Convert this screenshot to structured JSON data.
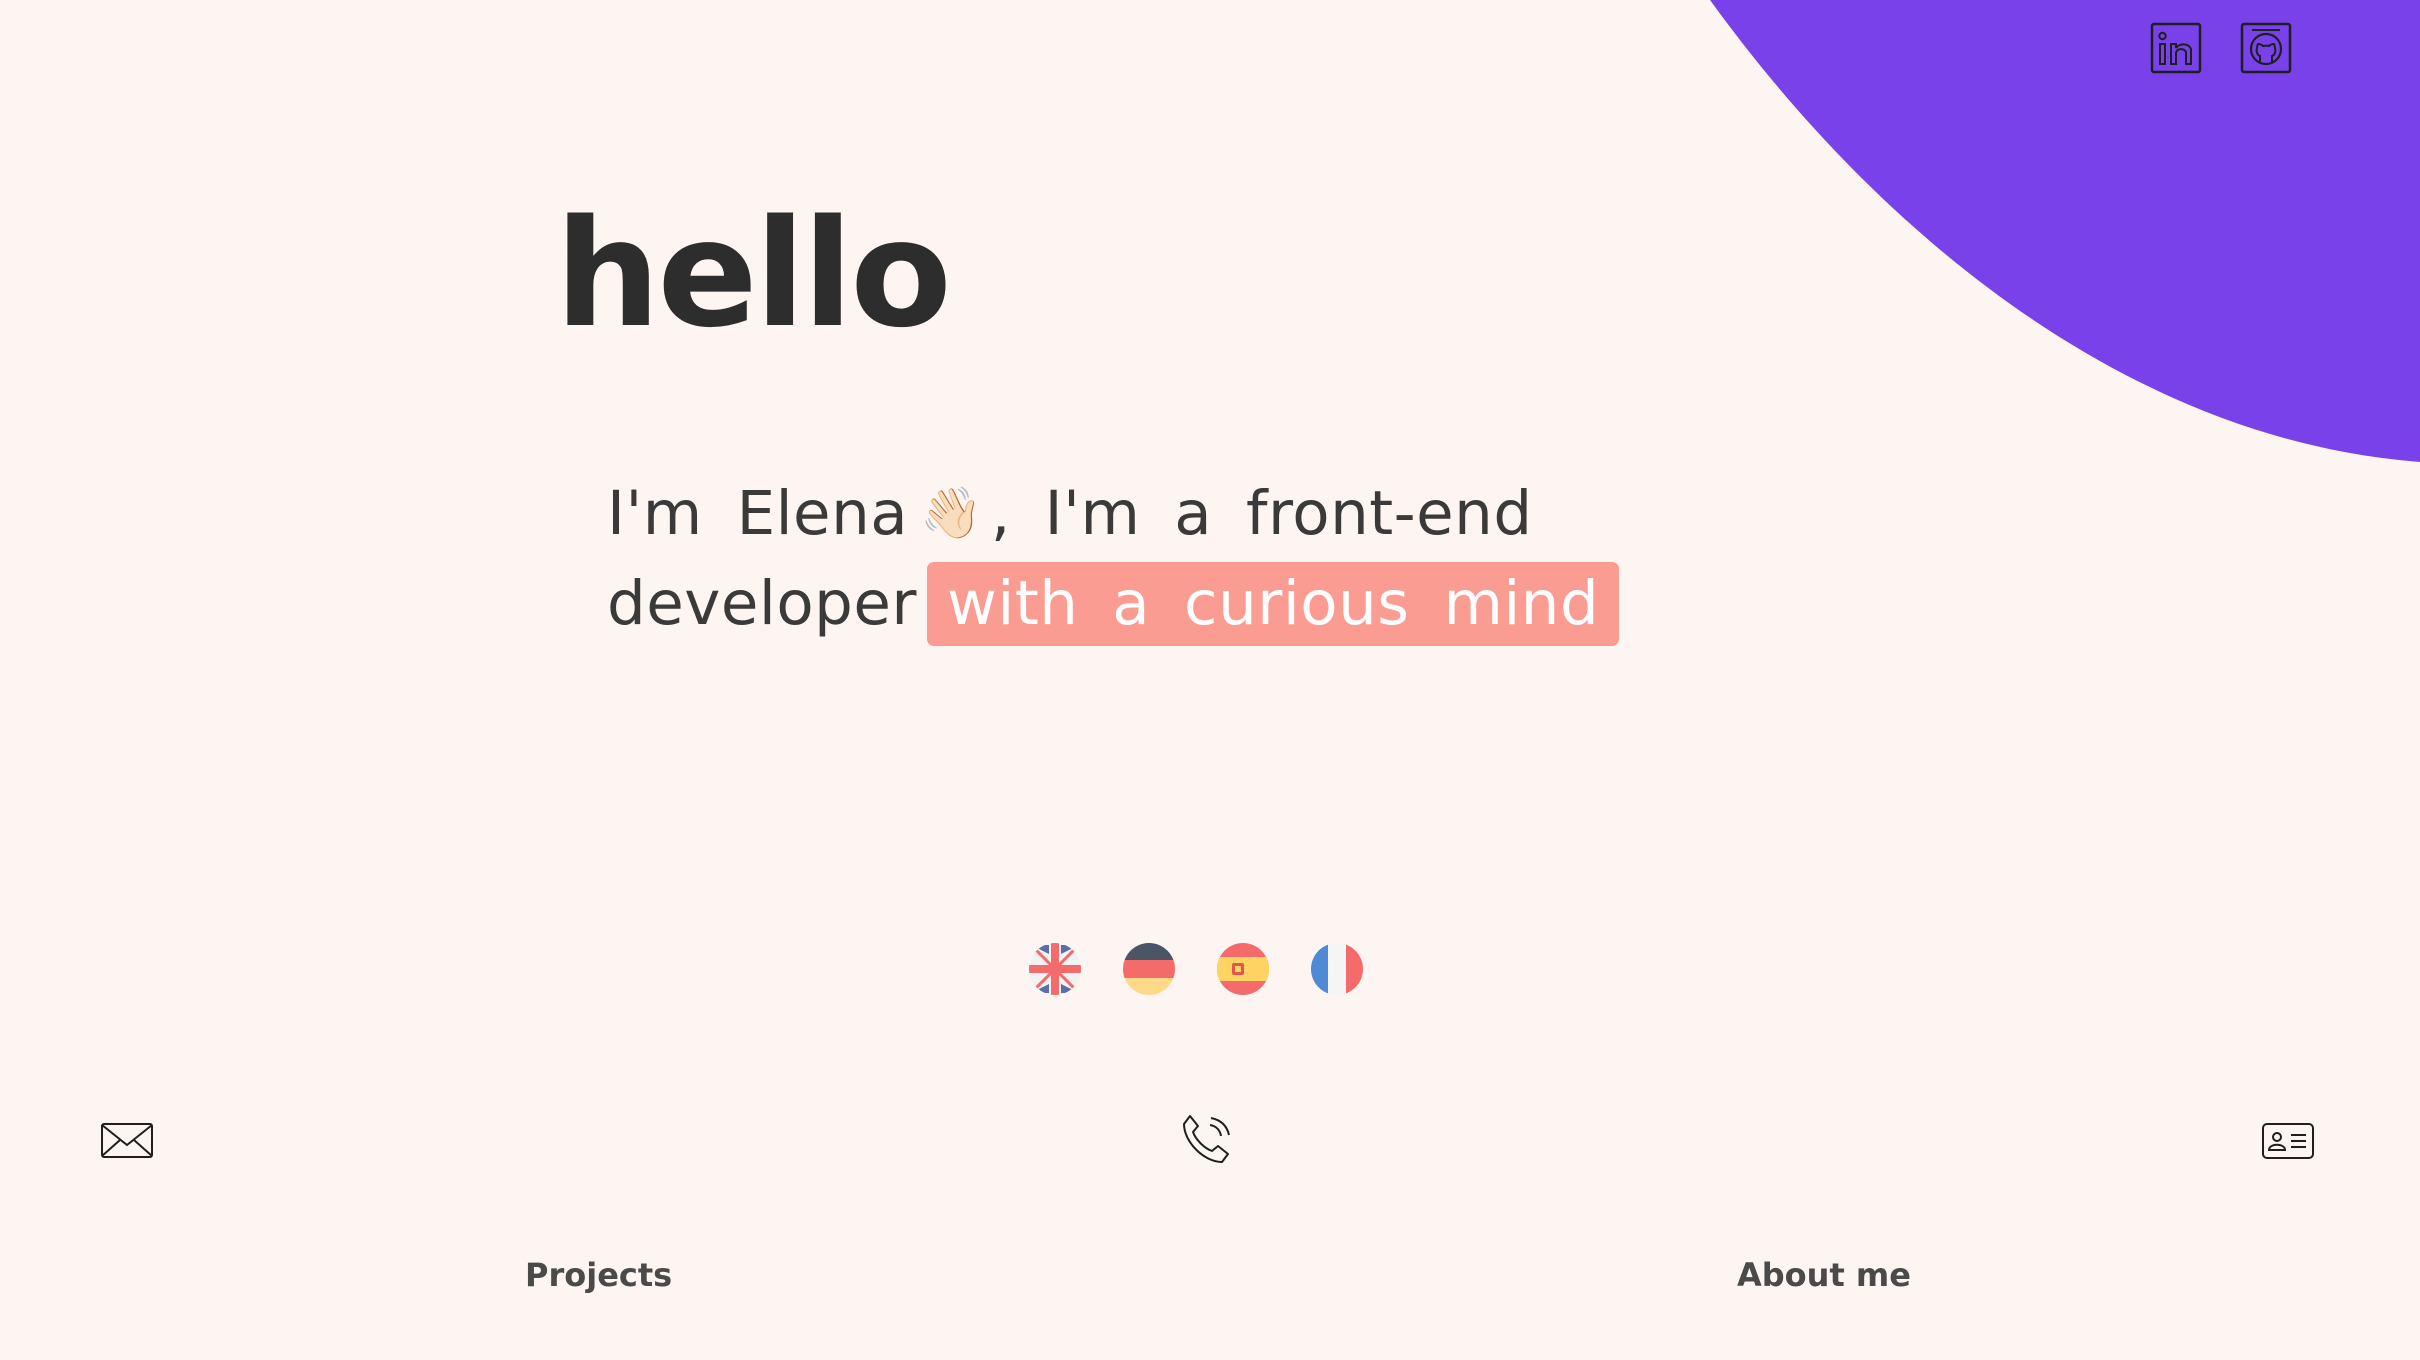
{
  "colors": {
    "background": "#fdf5f1",
    "accent_blob": "#7841ea",
    "highlight": "#fa9c92",
    "text": "#333333"
  },
  "header": {
    "social_icons": [
      "linkedin-icon",
      "github-icon"
    ]
  },
  "hero": {
    "greeting": "hello",
    "intro_part1": "I'm Elena",
    "wave_emoji": "👋🏻",
    "intro_part2": ", I'm a front-end developer",
    "intro_highlight": "with a curious mind"
  },
  "languages": {
    "flags": [
      "uk-flag-icon",
      "germany-flag-icon",
      "spain-flag-icon",
      "france-flag-icon"
    ]
  },
  "contact": {
    "icons": [
      "mail-icon",
      "phone-icon",
      "contact-card-icon"
    ]
  },
  "footer_nav": {
    "projects_label": "Projects",
    "about_label": "About me"
  }
}
